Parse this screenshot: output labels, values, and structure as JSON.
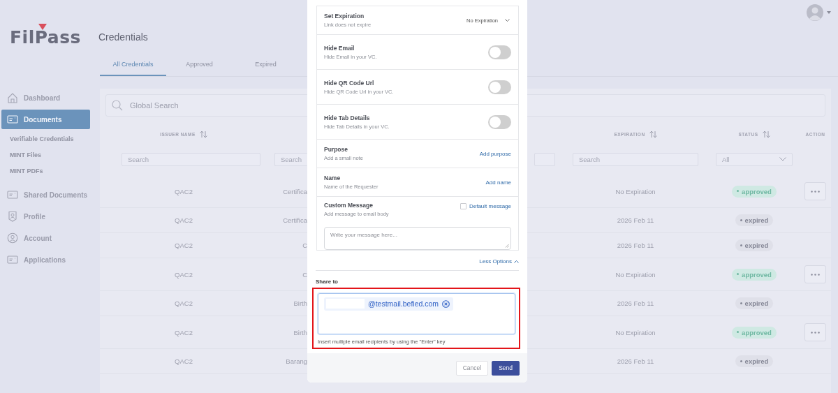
{
  "sidebar": {
    "logo": "FilPass",
    "items": [
      {
        "label": "Dashboard",
        "selected": false
      },
      {
        "label": "Documents",
        "selected": true,
        "children": [
          {
            "label": "Verifiable Credentials",
            "selected": false
          },
          {
            "label": "MINT Files",
            "selected": false
          },
          {
            "label": "MINT PDFs",
            "selected": false
          }
        ]
      },
      {
        "label": "Shared Documents",
        "selected": false
      },
      {
        "label": "Profile",
        "selected": false
      },
      {
        "label": "Account",
        "selected": false
      },
      {
        "label": "Applications",
        "selected": false
      }
    ]
  },
  "header": {
    "title": "Credentials",
    "tabs": [
      {
        "label": "All Credentials",
        "selected": true
      },
      {
        "label": "Approved",
        "selected": false
      },
      {
        "label": "Expired",
        "selected": false
      }
    ]
  },
  "table": {
    "search": {
      "placeholder": "Global Search"
    },
    "columns": [
      {
        "label": "ISSUER NAME",
        "sortable": true,
        "filter": {
          "kind": "text",
          "placeholder": "Search"
        }
      },
      {
        "filter": {
          "kind": "text",
          "placeholder": "Search"
        }
      },
      {},
      {
        "filter": {
          "kind": "text"
        }
      },
      {
        "label": "EXPIRATION",
        "sortable": true,
        "filter": {
          "kind": "text",
          "placeholder": "Search"
        }
      },
      {
        "label": "STATUS",
        "sortable": true,
        "filter": {
          "kind": "select",
          "value": "All"
        }
      },
      {
        "label": "ACTION",
        "sortable": false
      }
    ],
    "rows": [
      {
        "issuer": "QAC2",
        "column_2": "Certifica",
        "expiration": "No Expiration",
        "status": {
          "text": "approved",
          "approved": true
        },
        "menu_button": true
      },
      {
        "issuer": "QAC2",
        "column_2": "Certifica",
        "expiration": "2026 Feb 11",
        "status": {
          "text": "expired",
          "approved": false
        },
        "menu_button": false
      },
      {
        "issuer": "QAC2",
        "column_2": "C",
        "expiration": "2026 Feb 11",
        "status": {
          "text": "expired",
          "approved": false
        },
        "menu_button": false
      },
      {
        "issuer": "QAC2",
        "column_2": "C",
        "expiration": "No Expiration",
        "status": {
          "text": "approved",
          "approved": true
        },
        "menu_button": true
      },
      {
        "issuer": "QAC2",
        "column_2": "Birth",
        "expiration": "2026 Feb 11",
        "status": {
          "text": "expired",
          "approved": false
        },
        "menu_button": false
      },
      {
        "issuer": "QAC2",
        "column_2": "Birth",
        "expiration": "No Expiration",
        "status": {
          "text": "approved",
          "approved": true
        },
        "menu_button": true
      },
      {
        "issuer": "QAC2",
        "column_2": "Barang",
        "expiration": "2026 Feb 11",
        "status": {
          "text": "expired",
          "approved": false
        },
        "menu_button": false
      }
    ]
  },
  "modal": {
    "options": [
      {
        "kind": "select",
        "title": "Set Expiration",
        "subtitle": "Link does not expire",
        "value": "No Expiration"
      },
      {
        "kind": "toggle",
        "title": "Hide Email",
        "subtitle": "Hide Email in your VC.",
        "on": false
      },
      {
        "kind": "toggle",
        "title": "Hide QR Code Url",
        "subtitle": "Hide QR Code Url in your VC.",
        "on": false
      },
      {
        "kind": "toggle",
        "title": "Hide Tab Details",
        "subtitle": "Hide Tab Details in your VC.",
        "on": false
      },
      {
        "kind": "link",
        "title": "Purpose",
        "subtitle": "Add a small note",
        "action": "Add purpose"
      },
      {
        "kind": "link",
        "title": "Name",
        "subtitle": "Name of the Requester",
        "action": "Add name"
      },
      {
        "kind": "message",
        "title": "Custom Message",
        "subtitle": "Add message to email body",
        "checkbox_label": "Default message",
        "checked": false,
        "placeholder": "Write your message here..."
      }
    ],
    "less_options": "Less Options",
    "share_label": "Share to",
    "highlighted": true,
    "recipients": [
      {
        "email": "@testmail.befied.com",
        "redacted": true
      }
    ],
    "hint": "Insert multiple email recipients by using the \"Enter\" key",
    "buttons": [
      {
        "label": "Cancel",
        "kind": "secondary"
      },
      {
        "label": "Send",
        "kind": "primary"
      }
    ]
  }
}
